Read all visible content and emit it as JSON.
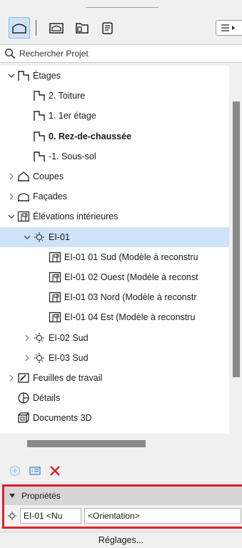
{
  "toolbar": {
    "icons": [
      "project-map-icon",
      "view-map-icon",
      "layout-book-icon",
      "publisher-icon"
    ],
    "menu_icon": "menu-icon"
  },
  "search": {
    "placeholder": "Rechercher Projet"
  },
  "tree": {
    "rows": [
      {
        "label": "Étages",
        "indent": 1,
        "chevron": "down",
        "icon": "story-icon",
        "bold": false,
        "selected": false
      },
      {
        "label": "2. Toiture",
        "indent": 2,
        "chevron": "",
        "icon": "story-icon",
        "bold": false,
        "selected": false
      },
      {
        "label": "1. 1er étage",
        "indent": 2,
        "chevron": "",
        "icon": "story-icon",
        "bold": false,
        "selected": false
      },
      {
        "label": "0. Rez-de-chaussée",
        "indent": 2,
        "chevron": "",
        "icon": "story-icon",
        "bold": true,
        "selected": false
      },
      {
        "label": "-1. Sous-sol",
        "indent": 2,
        "chevron": "",
        "icon": "story-icon",
        "bold": false,
        "selected": false
      },
      {
        "label": "Coupes",
        "indent": 1,
        "chevron": "right",
        "icon": "section-icon",
        "bold": false,
        "selected": false
      },
      {
        "label": "Façades",
        "indent": 1,
        "chevron": "right",
        "icon": "elevation-icon",
        "bold": false,
        "selected": false
      },
      {
        "label": "Élévations intérieures",
        "indent": 1,
        "chevron": "down",
        "icon": "interior-elevation-icon",
        "bold": false,
        "selected": false
      },
      {
        "label": "EI-01",
        "indent": 2,
        "chevron": "down",
        "icon": "ie-marker-icon",
        "bold": false,
        "selected": true
      },
      {
        "label": "EI-01 01 Sud (Modèle à reconstru",
        "indent": 3,
        "chevron": "",
        "icon": "interior-elevation-icon",
        "bold": false,
        "selected": false
      },
      {
        "label": "EI-01 02 Ouest (Modèle à reconst",
        "indent": 3,
        "chevron": "",
        "icon": "interior-elevation-icon",
        "bold": false,
        "selected": false
      },
      {
        "label": "EI-01 03 Nord (Modèle à reconstr",
        "indent": 3,
        "chevron": "",
        "icon": "interior-elevation-icon",
        "bold": false,
        "selected": false
      },
      {
        "label": "EI-01 04 Est (Modèle à reconstru",
        "indent": 3,
        "chevron": "",
        "icon": "interior-elevation-icon",
        "bold": false,
        "selected": false
      },
      {
        "label": "EI-02 Sud",
        "indent": 2,
        "chevron": "right",
        "icon": "ie-marker-icon",
        "bold": false,
        "selected": false
      },
      {
        "label": "EI-03 Sud",
        "indent": 2,
        "chevron": "right",
        "icon": "ie-marker-icon",
        "bold": false,
        "selected": false
      },
      {
        "label": "Feuilles de travail",
        "indent": 1,
        "chevron": "right",
        "icon": "worksheet-icon",
        "bold": false,
        "selected": false
      },
      {
        "label": "Détails",
        "indent": 1,
        "chevron": "",
        "icon": "detail-icon",
        "bold": false,
        "selected": false
      },
      {
        "label": "Documents 3D",
        "indent": 1,
        "chevron": "",
        "icon": "document-3d-icon",
        "bold": false,
        "selected": false
      }
    ]
  },
  "actions": {
    "icons": [
      "add-icon",
      "settings-list-icon",
      "delete-icon"
    ],
    "colors": {
      "add": "#9cc4ec",
      "list": "#3b82d6",
      "delete": "#e0202a"
    }
  },
  "properties": {
    "header": "Propriétés",
    "id_value": "EI-01 <Nu",
    "name_value": "<Orientation>",
    "settings_label": "Réglages..."
  },
  "colors": {
    "selected_row": "#cfe3f8",
    "highlight_border": "#e0202a"
  }
}
